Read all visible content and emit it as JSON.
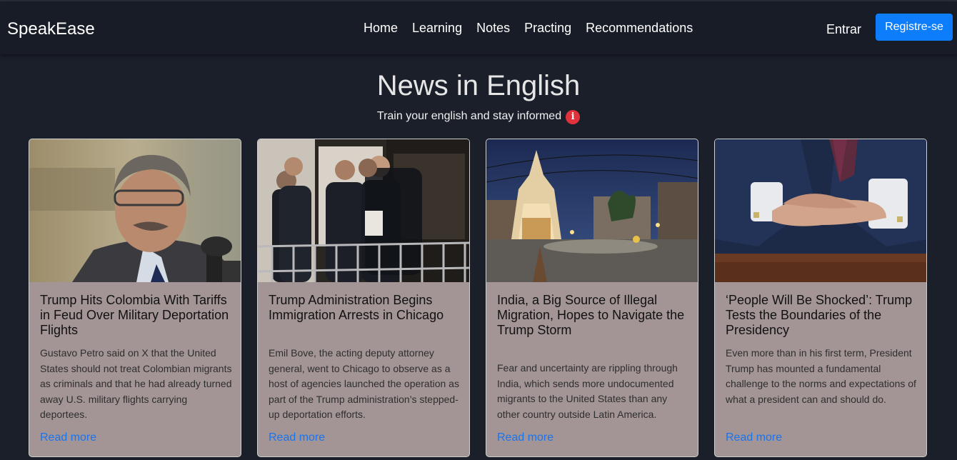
{
  "header": {
    "brand": "SpeakEase",
    "nav": [
      "Home",
      "Learning",
      "Notes",
      "Practing",
      "Recommendations"
    ],
    "login_label": "Entrar",
    "register_label": "Registre-se"
  },
  "main": {
    "title": "News in English",
    "subtitle": "Train your english and stay informed",
    "info_icon": "i"
  },
  "articles": [
    {
      "title": "Trump Hits Colombia With Tariffs in Feud Over Military Deportation Flights",
      "summary": "Gustavo Petro said on X that the United States should not treat Colombian migrants as criminals and that he had already turned away U.S. military flights carrying deportees.",
      "link": "Read more"
    },
    {
      "title": "Trump Administration Begins Immigration Arrests in Chicago",
      "summary": "Emil Bove, the acting deputy attorney general, went to Chicago to observe as a host of agencies launched the operation as part of the Trump administration’s stepped-up deportation efforts.",
      "link": "Read more"
    },
    {
      "title": "India, a Big Source of Illegal Migration, Hopes to Navigate the Trump Storm",
      "summary": "Fear and uncertainty are rippling through India, which sends more undocumented migrants to the United States than any other country outside Latin America.",
      "link": "Read more"
    },
    {
      "title": "‘People Will Be Shocked’: Trump Tests the Boundaries of the Presidency",
      "summary": "Even more than in his first term, President Trump has mounted a fundamental challenge to the norms and expectations of what a president can and should do.",
      "link": "Read more"
    }
  ]
}
